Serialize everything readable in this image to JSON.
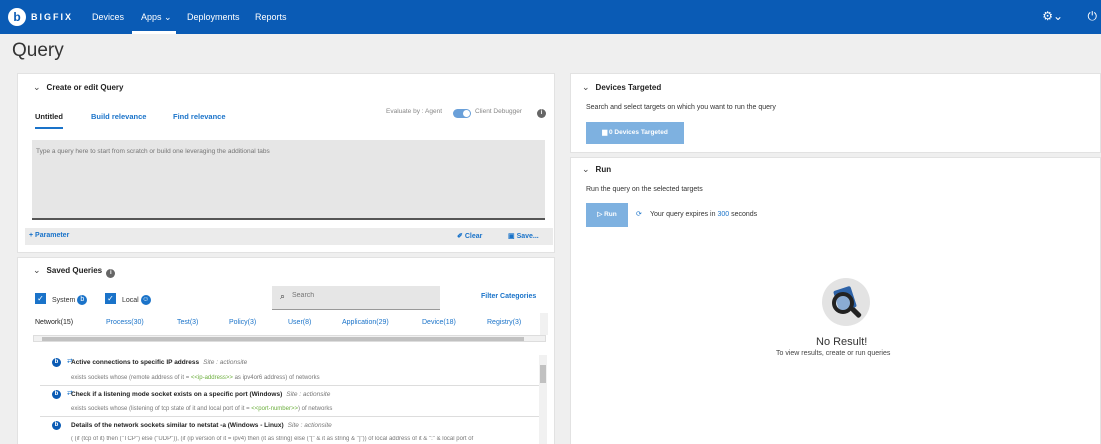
{
  "app": {
    "logo_letter": "b",
    "brand": "BIGFIX",
    "nav": [
      "Devices",
      "Apps ⌄",
      "Deployments",
      "Reports"
    ],
    "settings_icon": "gear-icon",
    "power_icon": "power-icon"
  },
  "page": {
    "title": "Query"
  },
  "editor": {
    "header": "Create or edit Query",
    "tabs": [
      "Untitled",
      "Build relevance",
      "Find relevance"
    ],
    "evaluate_label": "Evaluate by : Agent",
    "client_debugger": "Client Debugger",
    "placeholder": "Type a query here to start from scratch or build one leveraging the additional tabs",
    "parameter_label": "Parameter",
    "clear_label": "Clear",
    "save_label": "Save..."
  },
  "saved": {
    "header": "Saved Queries",
    "system_label": "System",
    "local_label": "Local",
    "search_placeholder": "Search",
    "filter_label": "Filter Categories",
    "categories": [
      "Network(15)",
      "Process(30)",
      "Test(3)",
      "Policy(3)",
      "User(8)",
      "Application(29)",
      "Device(18)",
      "Registry(3)"
    ],
    "items": [
      {
        "title": "Active connections to specific IP address",
        "site": "Site : actionsite",
        "expr_pre": "exists sockets whose (remote address of it = ",
        "expr_param": "<<ip-address>>",
        "expr_post": " as ipv4or6 address) of networks"
      },
      {
        "title": "Check if a listening mode socket exists on a specific port (Windows)",
        "site": "Site : actionsite",
        "expr_pre": "exists sockets whose (listening of tcp state of it and local port of it = ",
        "expr_param": "<<port-number>>",
        "expr_post": ") of networks"
      },
      {
        "title": "Details of the network sockets similar to netstat -a (Windows - Linux)",
        "site": "Site : actionsite",
        "expr_pre": "( (if (tcp of it) then (\"TCP\") else (\"UDP\")), (if (ip version of it = ipv4) then (it as string) else (\"[\" & it as string & \"]\")) of local address of it & \":\" & local port of",
        "expr_param": "",
        "expr_post": ""
      }
    ]
  },
  "targets": {
    "header": "Devices Targeted",
    "description": "Search and select targets on which you want to run the query",
    "button": "0 Devices Targeted"
  },
  "run": {
    "header": "Run",
    "description": "Run the query on the selected targets",
    "button": "▷ Run",
    "expires_pre": "Your query expires in",
    "expires_value": "300",
    "expires_post": "seconds"
  },
  "result": {
    "title": "No Result!",
    "subtitle": "To view results, create or run queries"
  }
}
